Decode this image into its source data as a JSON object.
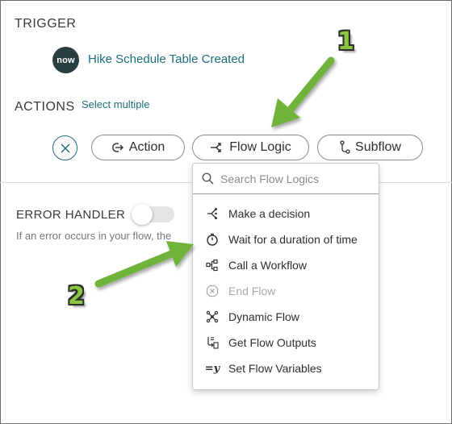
{
  "trigger": {
    "section_title": "TRIGGER",
    "logo_text": "now",
    "name": "Hike Schedule Table Created"
  },
  "actions": {
    "section_title": "ACTIONS",
    "select_multiple": "Select multiple",
    "buttons": {
      "action": "Action",
      "flow_logic": "Flow Logic",
      "subflow": "Subflow"
    }
  },
  "error_handler": {
    "title": "ERROR HANDLER",
    "toggle_on": false,
    "description": "If an error occurs in your flow, the"
  },
  "flow_logic_menu": {
    "search_placeholder": "Search Flow Logics",
    "items": [
      {
        "label": "Make a decision",
        "icon": "decision-icon",
        "disabled": false
      },
      {
        "label": "Wait for a duration of time",
        "icon": "stopwatch-icon",
        "disabled": false
      },
      {
        "label": "Call a Workflow",
        "icon": "workflow-icon",
        "disabled": false
      },
      {
        "label": "End Flow",
        "icon": "end-flow-icon",
        "disabled": true
      },
      {
        "label": "Dynamic Flow",
        "icon": "dynamic-flow-icon",
        "disabled": false
      },
      {
        "label": "Get Flow Outputs",
        "icon": "flow-outputs-icon",
        "disabled": false
      },
      {
        "label": "Set Flow Variables",
        "icon": "set-variables-icon",
        "disabled": false
      }
    ]
  },
  "annotations": {
    "callout_1": "1",
    "callout_2": "2",
    "arrow_color": "#6fb33a"
  },
  "colors": {
    "link": "#1c6e7e",
    "logo_bg": "#293e40"
  }
}
